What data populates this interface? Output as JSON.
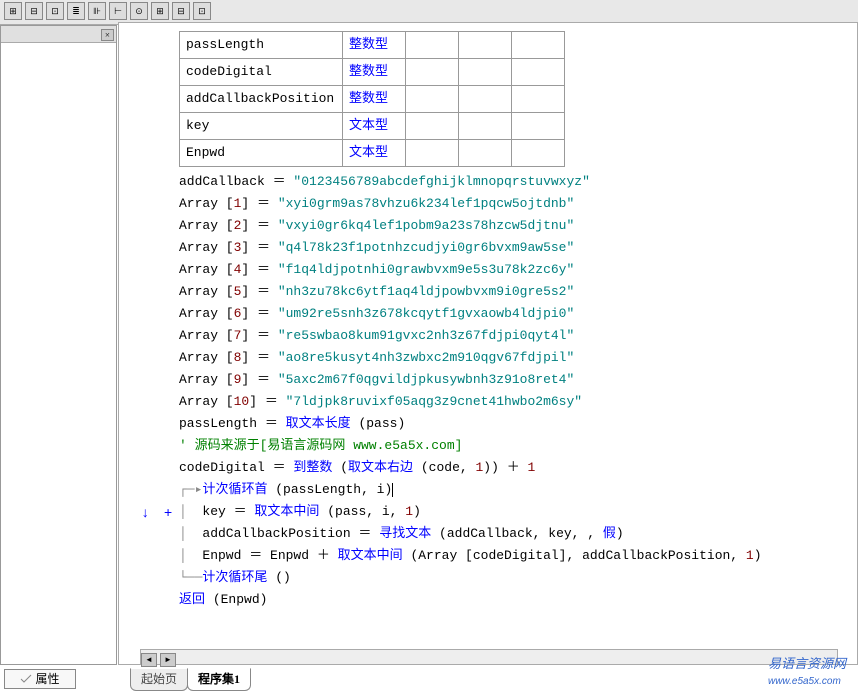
{
  "toolbar": [
    "⊞",
    "⊟",
    "⊡",
    "≣",
    "⊪",
    "⊢",
    "⊙",
    "⊞",
    "⊟",
    "⊡"
  ],
  "panel": {
    "close": "×"
  },
  "propBtn": "属性",
  "vars": [
    {
      "name": "passLength",
      "type": "整数型"
    },
    {
      "name": "codeDigital",
      "type": "整数型"
    },
    {
      "name": "addCallbackPosition",
      "type": "整数型"
    },
    {
      "name": "key",
      "type": "文本型"
    },
    {
      "name": "Enpwd",
      "type": "文本型"
    }
  ],
  "code": {
    "addCallback": "addCallback ＝ ",
    "addCallbackVal": "\"0123456789abcdefghijklmnopqrstuvwxyz\"",
    "arrays": [
      {
        "i": "1",
        "v": "\"xyi0grm9as78vhzu6k234lef1pqcw5ojtdnb\""
      },
      {
        "i": "2",
        "v": "\"vxyi0gr6kq4lef1pobm9a23s78hzcw5djtnu\""
      },
      {
        "i": "3",
        "v": "\"q4l78k23f1potnhzcudjyi0gr6bvxm9aw5se\""
      },
      {
        "i": "4",
        "v": "\"f1q4ldjpotnhi0grawbvxm9e5s3u78k2zc6y\""
      },
      {
        "i": "5",
        "v": "\"nh3zu78kc6ytf1aq4ldjpowbvxm9i0gre5s2\""
      },
      {
        "i": "6",
        "v": "\"um92re5snh3z678kcqytf1gvxaowb4ldjpi0\""
      },
      {
        "i": "7",
        "v": "\"re5swbao8kum91gvxc2nh3z67fdjpi0qyt4l\""
      },
      {
        "i": "8",
        "v": "\"ao8re5kusyt4nh3zwbxc2m910qgv67fdjpil\""
      },
      {
        "i": "9",
        "v": "\"5axc2m67f0qgvildjpkusywbnh3z91o8ret4\""
      },
      {
        "i": "10",
        "v": "\"7ldjpk8ruvixf05aqg3z9cnet41hwbo2m6sy\""
      }
    ],
    "passLen1": "passLength ＝ ",
    "passLen2": "取文本长度",
    "passLen3": " (pass)",
    "comment": "'  源码来源于[易语言源码网 www.e5a5x.com]",
    "cd1": "codeDigital ＝ ",
    "cd2": "到整数",
    "cd3": " (",
    "cd4": "取文本右边",
    "cd5": " (code, ",
    "cd6": "1",
    "cd7": ")) ＋ ",
    "cd8": "1",
    "loop1": "计次循环首",
    "loop1a": " (passLength, i)",
    "key1": "key ＝ ",
    "key2": "取文本中间",
    "key3": " (pass, i, ",
    "key4": "1",
    "key5": ")",
    "acp1": "addCallbackPosition ＝ ",
    "acp2": "寻找文本",
    "acp3": " (addCallback, key, , ",
    "acp4": "假",
    "acp5": ")",
    "ep1": "Enpwd ＝ Enpwd ＋ ",
    "ep2": "取文本中间",
    "ep3": " (Array [codeDigital], addCallbackPosition, ",
    "ep4": "1",
    "ep5": ")",
    "loop2": "计次循环尾",
    "loop2a": " ()",
    "ret1": "返回",
    "ret2": " (Enpwd)"
  },
  "gutter": {
    "down": "↓",
    "plus": "+"
  },
  "tabs": {
    "t1": "起始页",
    "t2": "程序集1"
  },
  "watermark": "易语言资源网",
  "watermark2": "www.e5a5x.com",
  "scroll": {
    "l": "◄",
    "r": "►"
  }
}
